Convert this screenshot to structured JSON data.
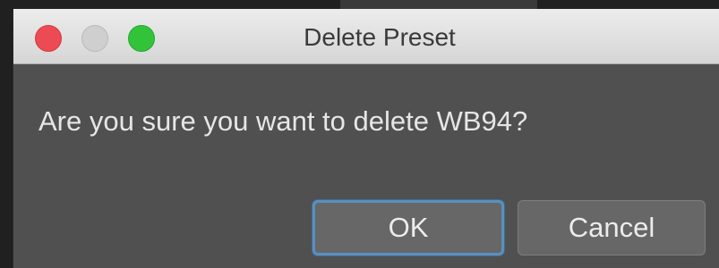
{
  "dialog": {
    "title": "Delete Preset",
    "message": "Are you sure you want to delete WB94?",
    "buttons": {
      "ok_label": "OK",
      "cancel_label": "Cancel"
    },
    "window_controls": {
      "close_color": "#ec4b54",
      "minimize_color": "#cfcfcf",
      "zoom_color": "#33c33b"
    }
  }
}
